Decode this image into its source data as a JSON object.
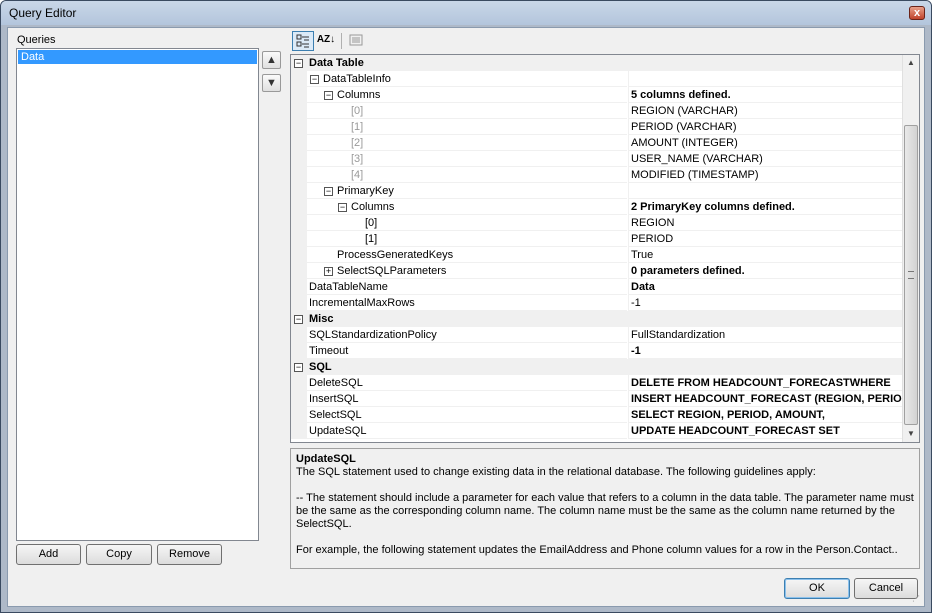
{
  "window": {
    "title": "Query Editor",
    "close_symbol": "x"
  },
  "queries": {
    "label": "Queries",
    "items": [
      "Data"
    ]
  },
  "buttons": {
    "add": "Add",
    "copy": "Copy",
    "remove": "Remove",
    "ok": "OK",
    "cancel": "Cancel"
  },
  "toolbar": {
    "categorized_icon": "categorized-icon",
    "alpha_label": "AZ↓",
    "pages_icon": "property-pages-icon"
  },
  "grid": {
    "rows": [
      {
        "kind": "cat",
        "toggle": "⊟",
        "name": "Data Table",
        "value": ""
      },
      {
        "kind": "prop",
        "indent": 0,
        "toggle": "⊟",
        "name": "DataTableInfo",
        "value": ""
      },
      {
        "kind": "prop",
        "indent": 1,
        "toggle": "⊟",
        "name": "Columns",
        "value": "5 columns defined.",
        "bold": true
      },
      {
        "kind": "prop",
        "indent": 2,
        "name": "[0]",
        "value": "REGION  (VARCHAR)",
        "muted": true
      },
      {
        "kind": "prop",
        "indent": 2,
        "name": "[1]",
        "value": "PERIOD  (VARCHAR)",
        "muted": true
      },
      {
        "kind": "prop",
        "indent": 2,
        "name": "[2]",
        "value": "AMOUNT  (INTEGER)",
        "muted": true
      },
      {
        "kind": "prop",
        "indent": 2,
        "name": "[3]",
        "value": "USER_NAME  (VARCHAR)",
        "muted": true
      },
      {
        "kind": "prop",
        "indent": 2,
        "name": "[4]",
        "value": "MODIFIED  (TIMESTAMP)",
        "muted": true
      },
      {
        "kind": "prop",
        "indent": 1,
        "toggle": "⊟",
        "name": "PrimaryKey",
        "value": ""
      },
      {
        "kind": "prop",
        "indent": 2,
        "toggle": "⊟",
        "name": "Columns",
        "value": "2 PrimaryKey columns defined.",
        "bold": true
      },
      {
        "kind": "prop",
        "indent": 3,
        "name": "[0]",
        "value": "REGION"
      },
      {
        "kind": "prop",
        "indent": 3,
        "name": "[1]",
        "value": "PERIOD"
      },
      {
        "kind": "prop",
        "indent": 1,
        "name": "ProcessGeneratedKeys",
        "value": "True"
      },
      {
        "kind": "prop",
        "indent": 1,
        "toggle": "⊞",
        "name": "SelectSQLParameters",
        "value": "0 parameters defined.",
        "bold": true
      },
      {
        "kind": "prop",
        "indent": 0,
        "name": "DataTableName",
        "value": "Data",
        "bold": true
      },
      {
        "kind": "prop",
        "indent": 0,
        "name": "IncrementalMaxRows",
        "value": "-1"
      },
      {
        "kind": "cat",
        "toggle": "⊟",
        "name": "Misc",
        "value": ""
      },
      {
        "kind": "prop",
        "indent": 0,
        "name": "SQLStandardizationPolicy",
        "value": "FullStandardization"
      },
      {
        "kind": "prop",
        "indent": 0,
        "name": "Timeout",
        "value": "-1",
        "bold": true
      },
      {
        "kind": "cat",
        "toggle": "⊟",
        "name": "SQL",
        "value": ""
      },
      {
        "kind": "prop",
        "indent": 0,
        "name": "DeleteSQL",
        "value": "DELETE FROM       HEADCOUNT_FORECASTWHERE",
        "bold": true
      },
      {
        "kind": "prop",
        "indent": 0,
        "name": "InsertSQL",
        "value": "INSERT HEADCOUNT_FORECAST       (REGION, PERIOD",
        "bold": true
      },
      {
        "kind": "prop",
        "indent": 0,
        "name": "SelectSQL",
        "value": "SELECT  REGION, PERIOD, AMOUNT,",
        "bold": true
      },
      {
        "kind": "prop",
        "indent": 0,
        "name": "UpdateSQL",
        "value": "UPDATE HEADCOUNT_FORECAST SET",
        "bold": true
      }
    ]
  },
  "description": {
    "title": "UpdateSQL",
    "line1": "The SQL statement used to change existing data in the relational database.  The following guidelines apply:",
    "line2": "-- The statement should include a parameter for each value that refers to a column in the data table.  The parameter name must be the same as the corresponding column name.  The column name must be the same as the column name returned by the SelectSQL.",
    "line3": "For example, the following statement updates the EmailAddress and Phone column values for a row in the Person.Contact.."
  }
}
